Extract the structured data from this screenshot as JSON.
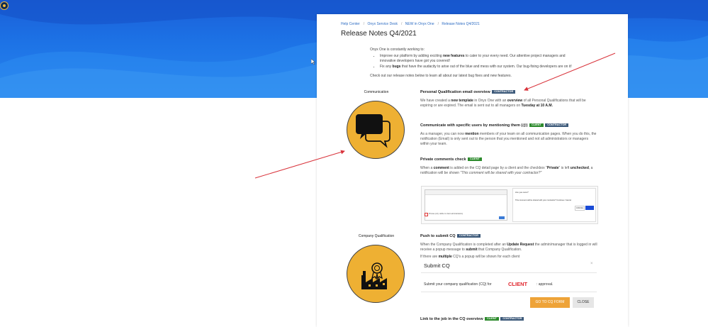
{
  "breadcrumb": [
    "Help Center",
    "Onyx Service Desk",
    "NEW in Onyx One",
    "Release Notes Q4/2021"
  ],
  "page_title": "Release Notes Q4/2021",
  "intro": {
    "lead": "Onyx One is constantly working to:",
    "bullet1": [
      "Improve our platform by adding exciting ",
      "new features",
      " to cater to your every need. Our attentive project managers and innovative developers have got you covered!"
    ],
    "bullet2": [
      "Fix any ",
      "bugs",
      " that have the audacity to arise out of the blue and mess with our system. Our bug-fixing developers are on it!"
    ],
    "check": "Check out our release notes below to learn all about our latest bug fixes and new features."
  },
  "sections": {
    "communication": {
      "label": "Communication",
      "icon": "chat-bubbles-icon",
      "items": {
        "email": {
          "title": "Personal Qualification email overview",
          "badges": [
            "CONTRACTOR"
          ],
          "text": [
            "We have created a ",
            "new template",
            " in Onyx One with an ",
            "overview",
            " of all Personal Qualifications that will be expiring or are expired. The email is sent out to all managers on ",
            "Tuesday at 10 A.M."
          ]
        },
        "mention": {
          "title": "Communicate with specific users by mentioning them (@)",
          "badges": [
            "CLIENT",
            "CONTRACTOR"
          ],
          "text": [
            "As a manager, you can now ",
            "mention",
            " members of your team on all communication pages. When you do this, the notification (Email) is only sent out to the person that you mentioned and not all administrators or managers within your team."
          ]
        },
        "private": {
          "title": "Private comments check",
          "badges": [
            "CLIENT"
          ],
          "text": [
            "When a ",
            "comment",
            " is added on the CQ detail page by a client and the checkbox \"",
            "Private",
            "\" is left ",
            "unchecked",
            ", a notification will be shown ",
            "\"This comment will be shared with your contractor?\""
          ]
        },
        "screenshot": {
          "dialog_title": "Are you sure?",
          "dialog_msg": "This comment will be shared with your contractor? Continue / Cancel",
          "cancel": "CANCEL",
          "checkbox_label": "Private (only visible to client administrators)"
        }
      }
    },
    "company_qualification": {
      "label": "Company Qualification",
      "icon": "factory-award-icon",
      "items": {
        "push": {
          "title": "Push to submit CQ",
          "badges": [
            "CONTRACTOR"
          ],
          "text": [
            "When the Company Qualification is completed after an ",
            "Update Request",
            " the admin/manager that is logged in will receive a popup message to ",
            "submit",
            " that Company Qualification."
          ],
          "text2": [
            "If there are ",
            "multiple",
            " CQ's a popup will be shown for each client"
          ]
        },
        "modal": {
          "title": "Submit CQ",
          "msg": "Submit your company qualification (CQ) for",
          "client": "CLIENT",
          "approval": ": approval.",
          "primary": "GO TO CQ FORM",
          "secondary": "CLOSE"
        },
        "link": {
          "title": "Link to the job in the CQ overview",
          "badges": [
            "CLIENT",
            "CONTRACTOR"
          ]
        }
      }
    }
  },
  "colors": {
    "hero_blue": "#1d73e6",
    "accent_gold": "#eeb033",
    "badge_contractor": "#3d5a7a",
    "badge_client": "#2e8b2e",
    "arrow_red": "#d9343c"
  }
}
